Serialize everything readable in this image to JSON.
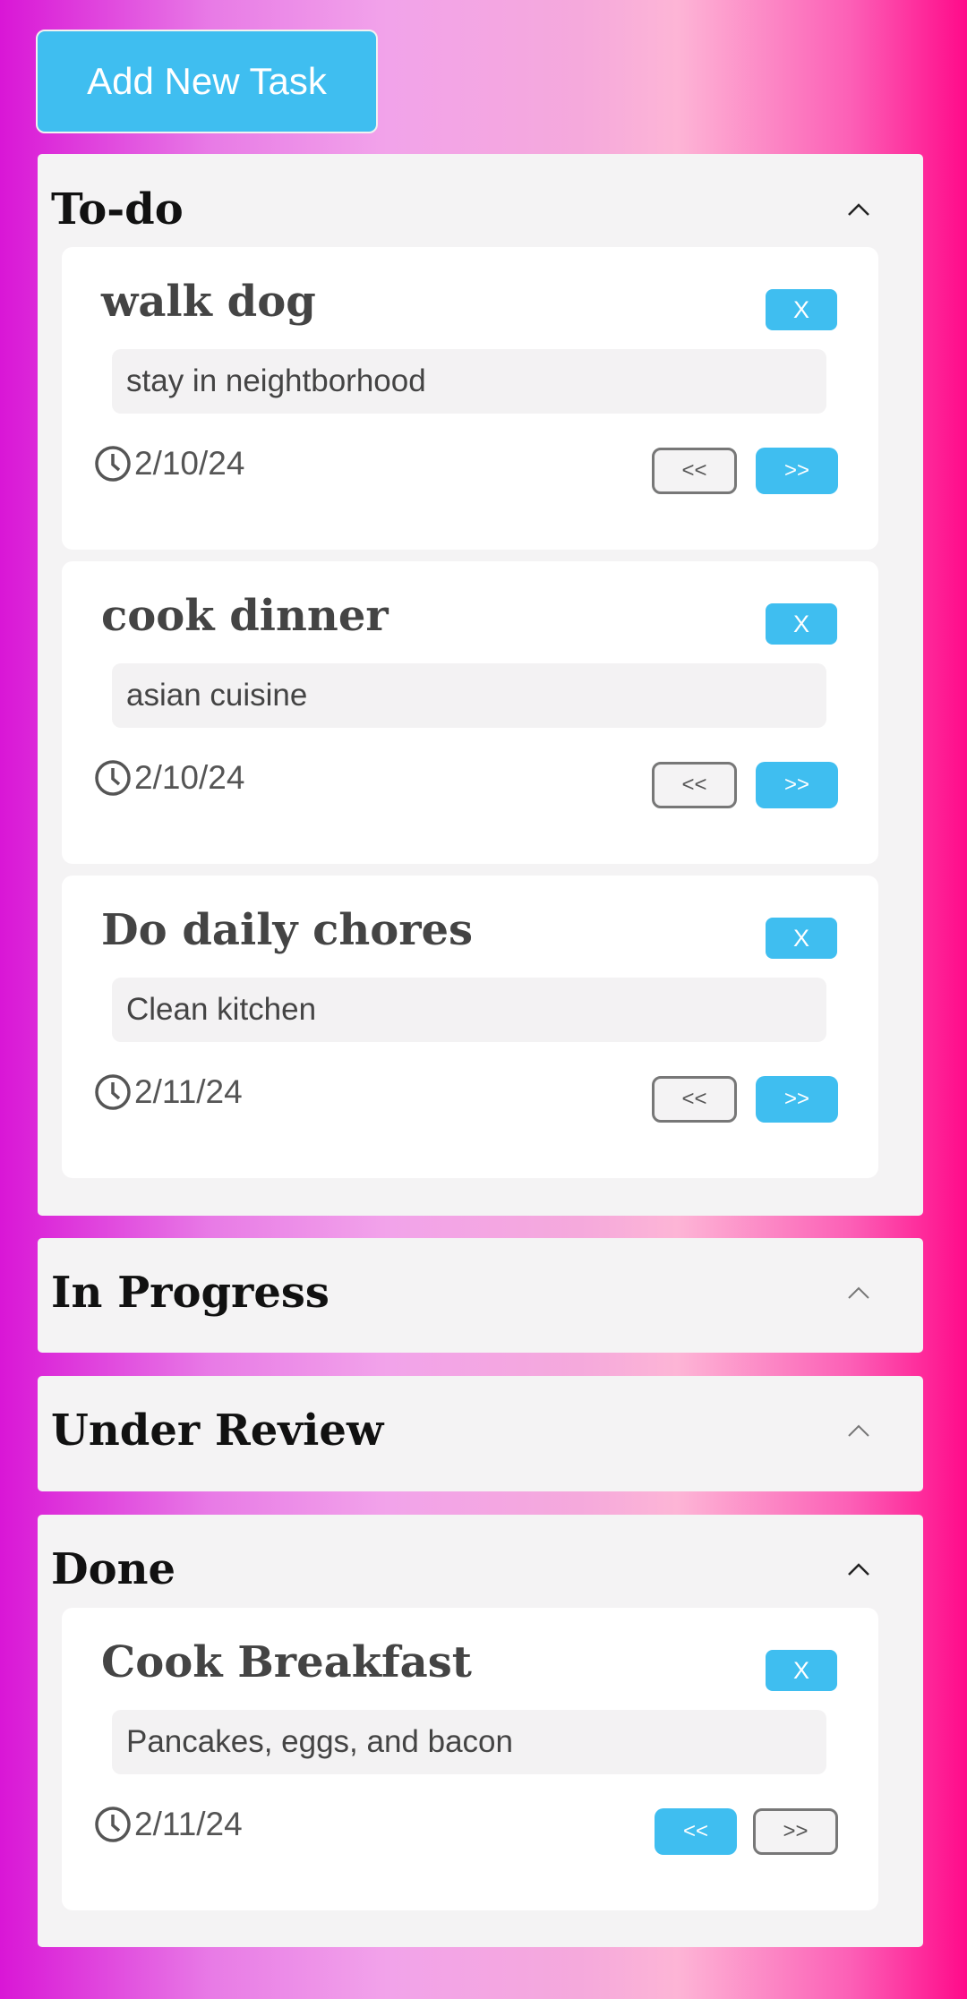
{
  "add_button_label": "Add New Task",
  "colors": {
    "accent": "#3fbef0",
    "panel": "#f4f3f4",
    "card": "#ffffff",
    "gradient_left": "#d916d6",
    "gradient_right": "#ff0a8a"
  },
  "sections": {
    "todo": {
      "title": "To-do",
      "chevron_icon": "chevron-up-icon",
      "tasks": [
        {
          "title": "walk dog",
          "description": "stay in neightborhood",
          "date": "2/10/24",
          "delete_label": "X",
          "prev_label": "<<",
          "next_label": ">>"
        },
        {
          "title": "cook dinner",
          "description": "asian cuisine",
          "date": "2/10/24",
          "delete_label": "X",
          "prev_label": "<<",
          "next_label": ">>"
        },
        {
          "title": "Do daily chores",
          "description": "Clean kitchen",
          "date": "2/11/24",
          "delete_label": "X",
          "prev_label": "<<",
          "next_label": ">>"
        }
      ]
    },
    "in_progress": {
      "title": "In Progress",
      "chevron_icon": "chevron-up-icon",
      "tasks": []
    },
    "under_review": {
      "title": "Under Review",
      "chevron_icon": "chevron-up-icon",
      "tasks": []
    },
    "done": {
      "title": "Done",
      "chevron_icon": "chevron-up-icon",
      "tasks": [
        {
          "title": "Cook Breakfast",
          "description": "Pancakes, eggs, and bacon",
          "date": "2/11/24",
          "delete_label": "X",
          "prev_label": "<<",
          "next_label": ">>"
        }
      ]
    }
  },
  "icons": {
    "date_icon": "clock-icon"
  }
}
